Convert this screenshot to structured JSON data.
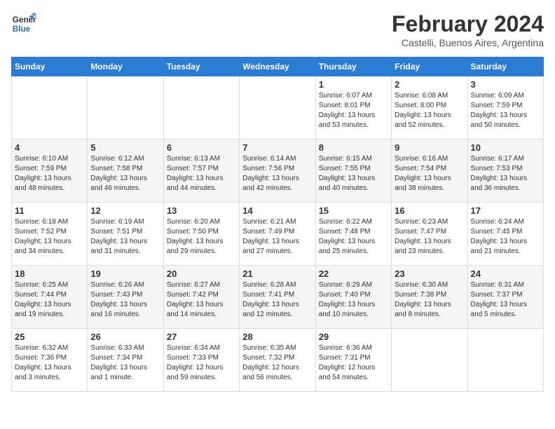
{
  "header": {
    "logo_line1": "General",
    "logo_line2": "Blue",
    "title": "February 2024",
    "subtitle": "Castelli, Buenos Aires, Argentina"
  },
  "calendar": {
    "days_of_week": [
      "Sunday",
      "Monday",
      "Tuesday",
      "Wednesday",
      "Thursday",
      "Friday",
      "Saturday"
    ],
    "weeks": [
      [
        {
          "day": "",
          "info": ""
        },
        {
          "day": "",
          "info": ""
        },
        {
          "day": "",
          "info": ""
        },
        {
          "day": "",
          "info": ""
        },
        {
          "day": "1",
          "info": "Sunrise: 6:07 AM\nSunset: 8:01 PM\nDaylight: 13 hours\nand 53 minutes."
        },
        {
          "day": "2",
          "info": "Sunrise: 6:08 AM\nSunset: 8:00 PM\nDaylight: 13 hours\nand 52 minutes."
        },
        {
          "day": "3",
          "info": "Sunrise: 6:09 AM\nSunset: 7:59 PM\nDaylight: 13 hours\nand 50 minutes."
        }
      ],
      [
        {
          "day": "4",
          "info": "Sunrise: 6:10 AM\nSunset: 7:59 PM\nDaylight: 13 hours\nand 48 minutes."
        },
        {
          "day": "5",
          "info": "Sunrise: 6:12 AM\nSunset: 7:58 PM\nDaylight: 13 hours\nand 46 minutes."
        },
        {
          "day": "6",
          "info": "Sunrise: 6:13 AM\nSunset: 7:57 PM\nDaylight: 13 hours\nand 44 minutes."
        },
        {
          "day": "7",
          "info": "Sunrise: 6:14 AM\nSunset: 7:56 PM\nDaylight: 13 hours\nand 42 minutes."
        },
        {
          "day": "8",
          "info": "Sunrise: 6:15 AM\nSunset: 7:55 PM\nDaylight: 13 hours\nand 40 minutes."
        },
        {
          "day": "9",
          "info": "Sunrise: 6:16 AM\nSunset: 7:54 PM\nDaylight: 13 hours\nand 38 minutes."
        },
        {
          "day": "10",
          "info": "Sunrise: 6:17 AM\nSunset: 7:53 PM\nDaylight: 13 hours\nand 36 minutes."
        }
      ],
      [
        {
          "day": "11",
          "info": "Sunrise: 6:18 AM\nSunset: 7:52 PM\nDaylight: 13 hours\nand 34 minutes."
        },
        {
          "day": "12",
          "info": "Sunrise: 6:19 AM\nSunset: 7:51 PM\nDaylight: 13 hours\nand 31 minutes."
        },
        {
          "day": "13",
          "info": "Sunrise: 6:20 AM\nSunset: 7:50 PM\nDaylight: 13 hours\nand 29 minutes."
        },
        {
          "day": "14",
          "info": "Sunrise: 6:21 AM\nSunset: 7:49 PM\nDaylight: 13 hours\nand 27 minutes."
        },
        {
          "day": "15",
          "info": "Sunrise: 6:22 AM\nSunset: 7:48 PM\nDaylight: 13 hours\nand 25 minutes."
        },
        {
          "day": "16",
          "info": "Sunrise: 6:23 AM\nSunset: 7:47 PM\nDaylight: 13 hours\nand 23 minutes."
        },
        {
          "day": "17",
          "info": "Sunrise: 6:24 AM\nSunset: 7:45 PM\nDaylight: 13 hours\nand 21 minutes."
        }
      ],
      [
        {
          "day": "18",
          "info": "Sunrise: 6:25 AM\nSunset: 7:44 PM\nDaylight: 13 hours\nand 19 minutes."
        },
        {
          "day": "19",
          "info": "Sunrise: 6:26 AM\nSunset: 7:43 PM\nDaylight: 13 hours\nand 16 minutes."
        },
        {
          "day": "20",
          "info": "Sunrise: 6:27 AM\nSunset: 7:42 PM\nDaylight: 13 hours\nand 14 minutes."
        },
        {
          "day": "21",
          "info": "Sunrise: 6:28 AM\nSunset: 7:41 PM\nDaylight: 13 hours\nand 12 minutes."
        },
        {
          "day": "22",
          "info": "Sunrise: 6:29 AM\nSunset: 7:40 PM\nDaylight: 13 hours\nand 10 minutes."
        },
        {
          "day": "23",
          "info": "Sunrise: 6:30 AM\nSunset: 7:38 PM\nDaylight: 13 hours\nand 8 minutes."
        },
        {
          "day": "24",
          "info": "Sunrise: 6:31 AM\nSunset: 7:37 PM\nDaylight: 13 hours\nand 5 minutes."
        }
      ],
      [
        {
          "day": "25",
          "info": "Sunrise: 6:32 AM\nSunset: 7:36 PM\nDaylight: 13 hours\nand 3 minutes."
        },
        {
          "day": "26",
          "info": "Sunrise: 6:33 AM\nSunset: 7:34 PM\nDaylight: 13 hours\nand 1 minute."
        },
        {
          "day": "27",
          "info": "Sunrise: 6:34 AM\nSunset: 7:33 PM\nDaylight: 12 hours\nand 59 minutes."
        },
        {
          "day": "28",
          "info": "Sunrise: 6:35 AM\nSunset: 7:32 PM\nDaylight: 12 hours\nand 56 minutes."
        },
        {
          "day": "29",
          "info": "Sunrise: 6:36 AM\nSunset: 7:31 PM\nDaylight: 12 hours\nand 54 minutes."
        },
        {
          "day": "",
          "info": ""
        },
        {
          "day": "",
          "info": ""
        }
      ]
    ]
  }
}
